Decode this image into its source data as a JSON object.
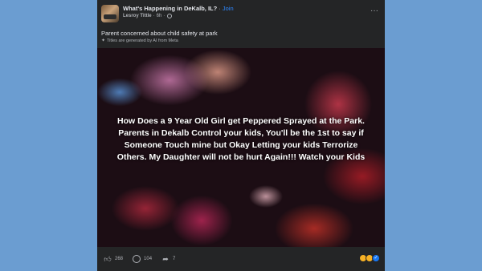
{
  "post": {
    "group_name": "What's Happening in DeKalb, IL?",
    "join_label": "Join",
    "author": "Lesroy Tittle",
    "time": "6h",
    "title": "Parent concerned about child safety at park",
    "ai_note": "Titles are generated by AI from Meta",
    "image_text": "How Does a 9 Year Old Girl get Peppered Sprayed at the Park. Parents in Dekalb Control your kids, You'll be the 1st to say if Someone Touch mine but Okay Letting your kids Terrorize Others. My Daughter will not be hurt Again!!! Watch your Kids",
    "likes": "268",
    "comments": "104",
    "shares": "7"
  },
  "icons": {
    "more": "more-icon",
    "like": "like-icon",
    "comment": "comment-icon",
    "share": "share-icon",
    "globe": "globe-icon",
    "sparkle": "sparkle-icon"
  },
  "colors": {
    "page_bg": "#6b9dd1",
    "card_bg": "#242526",
    "link": "#2d88ff"
  }
}
